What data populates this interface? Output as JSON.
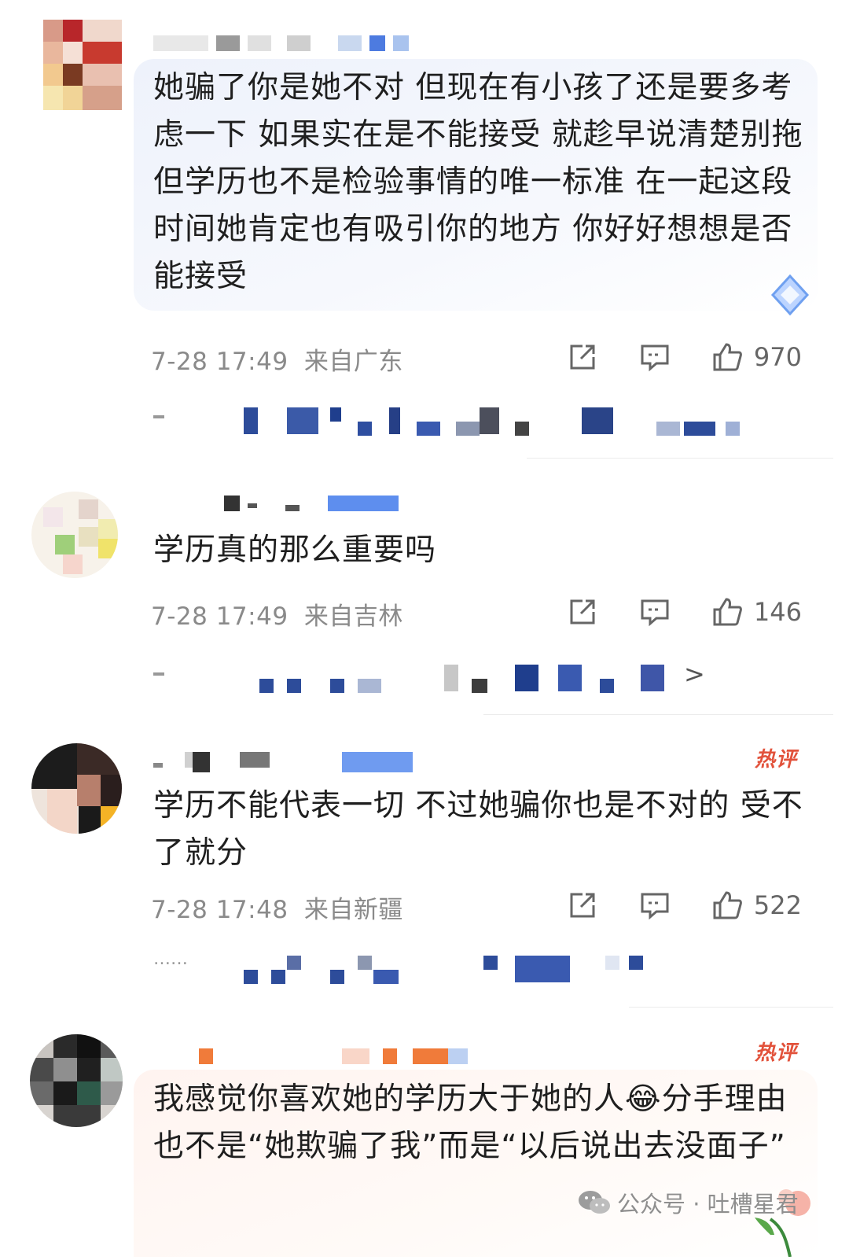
{
  "comments": [
    {
      "text": "她骗了你是她不对 但现在有小孩了还是要多考虑一下 如果实在是不能接受 就趁早说清楚别拖 但学历也不是检验事情的唯一标准 在一起这段时间她肯定也有吸引你的地方 你好好想想是否能接受",
      "time": "7-28 17:49",
      "location": "来自广东",
      "likes": "970",
      "hot_label": ""
    },
    {
      "text": "学历真的那么重要吗",
      "time": "7-28 17:49",
      "location": "来自吉林",
      "likes": "146",
      "hot_label": "",
      "more_arrow": ">"
    },
    {
      "text": "学历不能代表一切 不过她骗你也是不对的 受不了就分",
      "time": "7-28 17:48",
      "location": "来自新疆",
      "likes": "522",
      "hot_label": "热评",
      "reply_prefix": "……"
    },
    {
      "text": "我感觉你喜欢她的学历大于她的人😂分手理由也不是“她欺骗了我”而是“以后说出去没面子”",
      "hot_label": "热评"
    }
  ],
  "watermark": {
    "label": "公众号 · 吐槽星君"
  },
  "colors": {
    "meta_gray": "#8a8a8a",
    "hot_red": "#e2523b",
    "bubble_blue": "#eef2fb",
    "bubble_warm": "#fff4f0"
  }
}
